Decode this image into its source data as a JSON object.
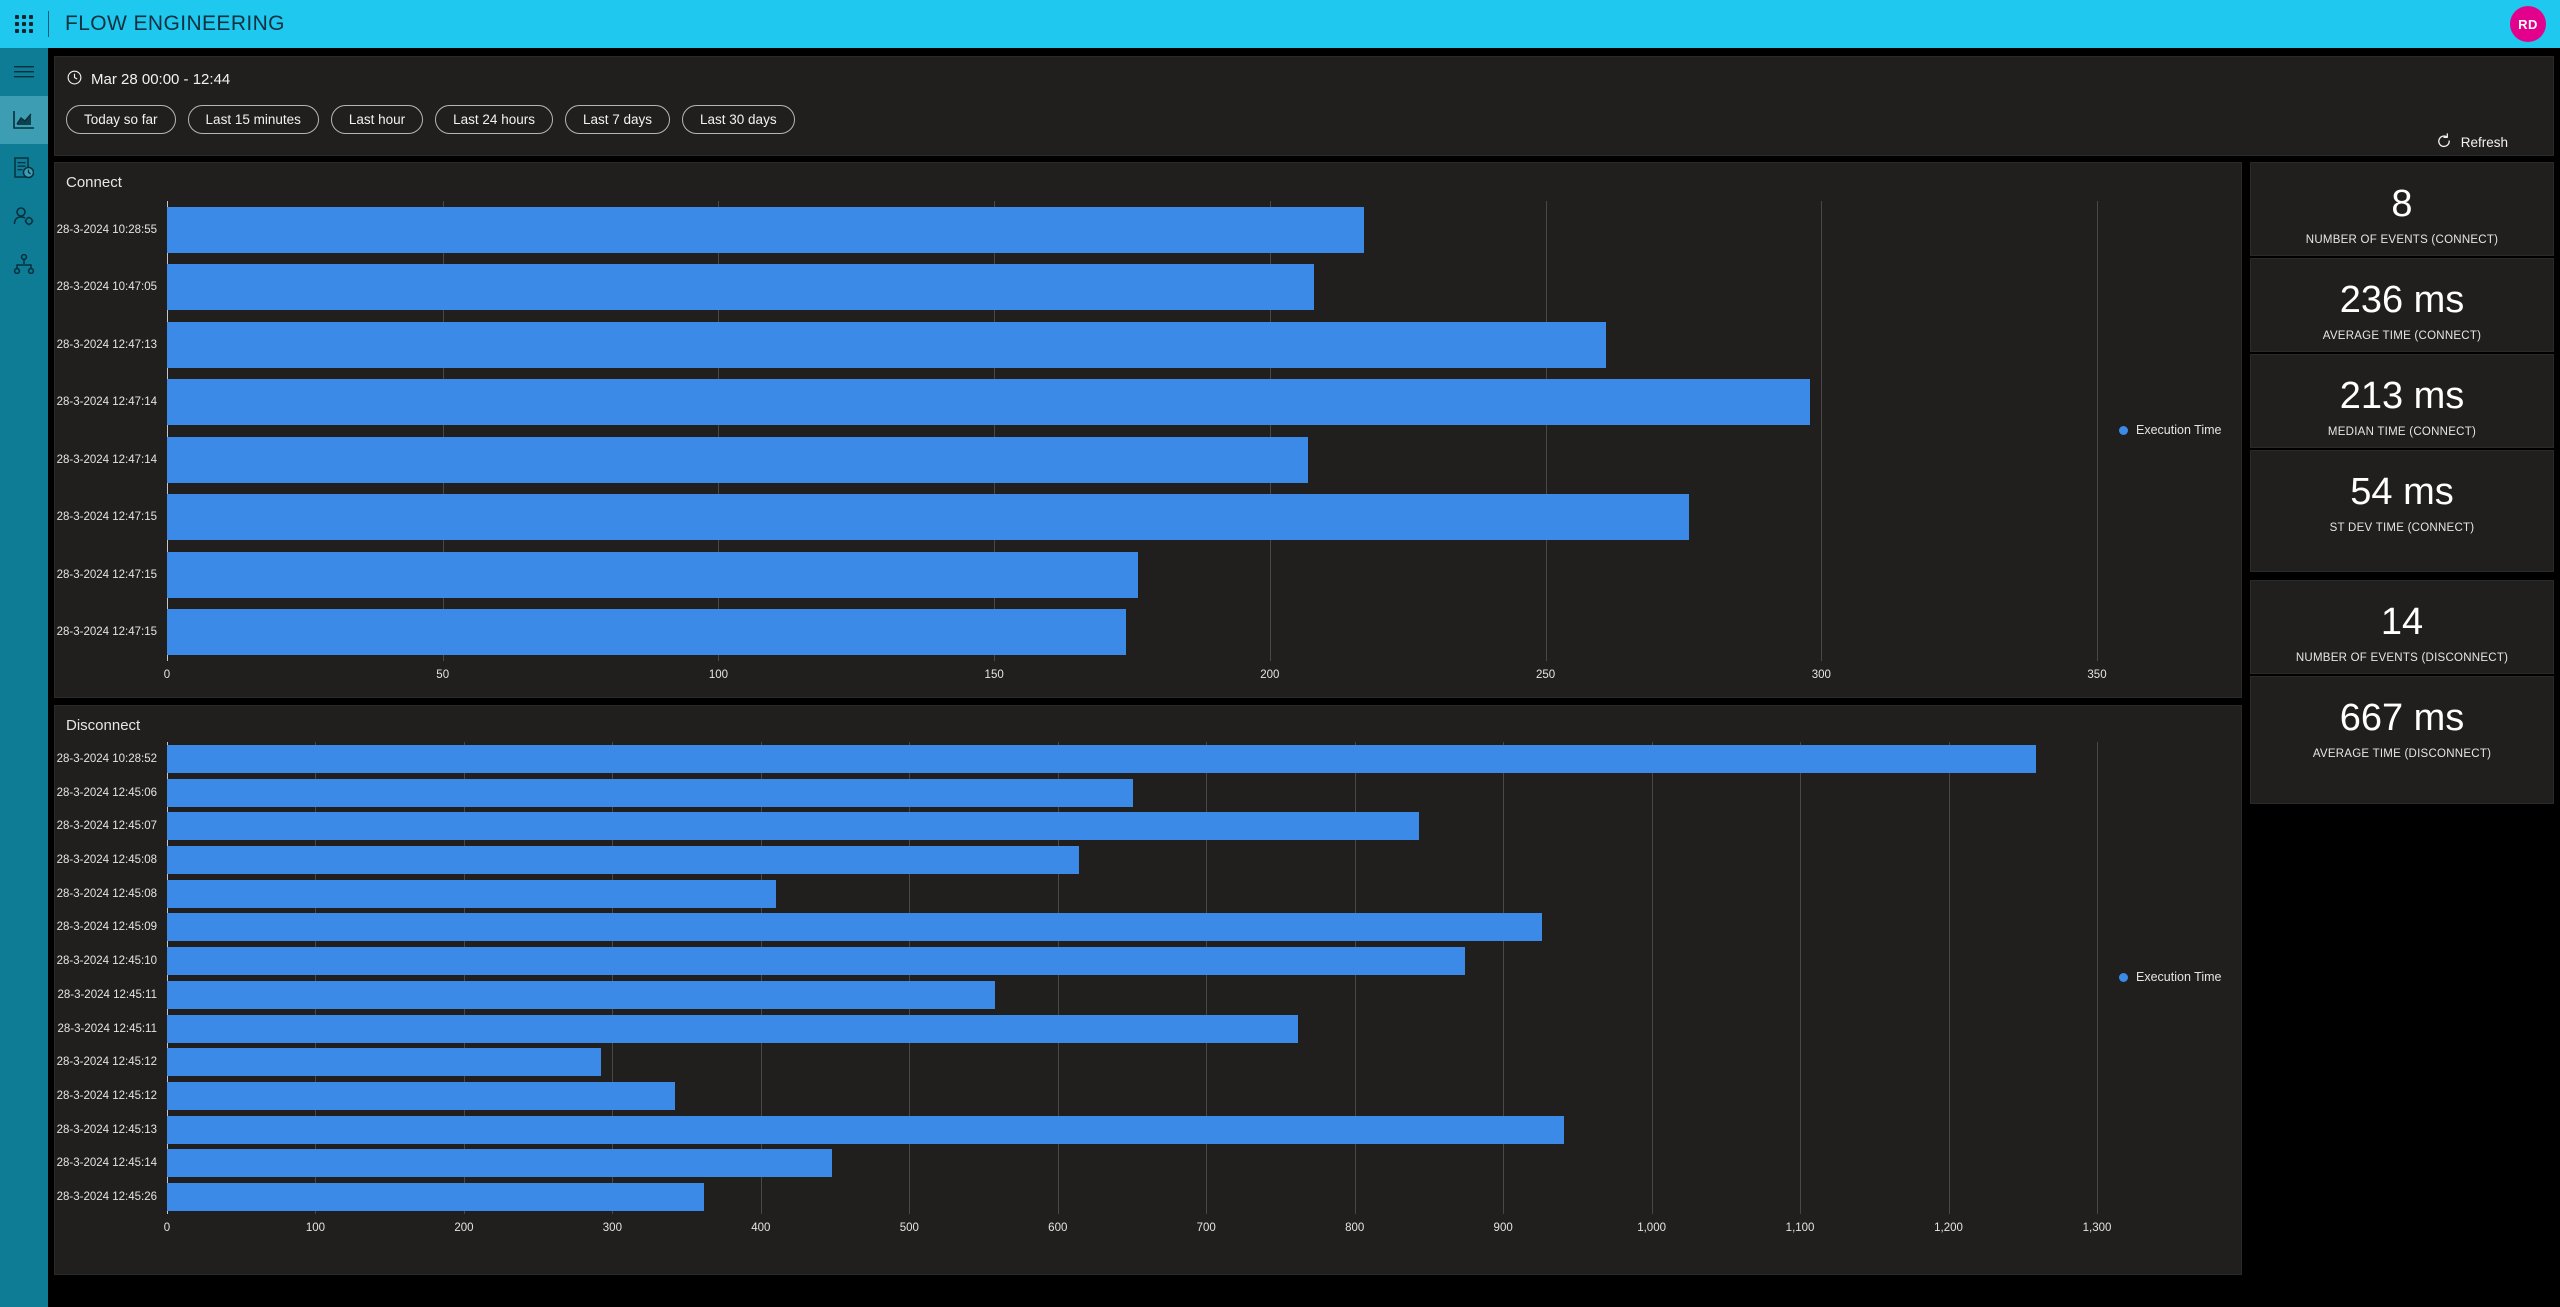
{
  "topbar": {
    "waffle_icon": "app-launcher-icon",
    "app_title": "FLOW ENGINEERING",
    "avatar_initials": "RD",
    "avatar_color": "#e3008c",
    "background_color": "#1ec8ee"
  },
  "rail": {
    "items": [
      {
        "icon": "hamburger-menu-icon",
        "name": "menu",
        "active": false
      },
      {
        "icon": "chart-report-icon",
        "name": "reports",
        "active": true
      },
      {
        "icon": "document-clock-icon",
        "name": "scheduled-documents",
        "active": false
      },
      {
        "icon": "user-settings-icon",
        "name": "user-settings",
        "active": false
      },
      {
        "icon": "workflow-branch-icon",
        "name": "workflows",
        "active": false
      }
    ]
  },
  "timepanel": {
    "clock_icon": "clock-icon",
    "range_label": "Mar 28 00:00 - 12:44",
    "pills": [
      "Today so far",
      "Last 15 minutes",
      "Last hour",
      "Last 24 hours",
      "Last 7 days",
      "Last 30 days"
    ]
  },
  "legend_label": "Execution Time",
  "accent_color": "#3b8ae8",
  "kpis": [
    {
      "value": "8",
      "label": "NUMBER OF EVENTS (CONNECT)",
      "size": 38
    },
    {
      "value": "236 ms",
      "label": "AVERAGE TIME (CONNECT)",
      "size": 38
    },
    {
      "value": "213 ms",
      "label": "MEDIAN TIME (CONNECT)",
      "size": 38
    },
    {
      "value": "54 ms",
      "label": "ST DEV TIME (CONNECT)",
      "size": 38
    },
    {
      "value": "14",
      "label": "NUMBER OF EVENTS (DISCONNECT)",
      "size": 38
    },
    {
      "value": "667 ms",
      "label": "AVERAGE TIME (DISCONNECT)",
      "size": 38
    }
  ],
  "refresh": {
    "icon": "refresh-icon",
    "label": "Refresh"
  },
  "chart_data": [
    {
      "type": "bar",
      "orientation": "horizontal",
      "title": "Connect",
      "xlabel": "",
      "ylabel": "",
      "xlim": [
        0,
        350
      ],
      "xticks": [
        0,
        50,
        100,
        150,
        200,
        250,
        300,
        350
      ],
      "grid": true,
      "legend": [
        "Execution Time"
      ],
      "legend_position": "right",
      "categories": [
        "28-3-2024 10:28:55",
        "28-3-2024 10:47:05",
        "28-3-2024 12:47:13",
        "28-3-2024 12:47:14",
        "28-3-2024 12:47:14",
        "28-3-2024 12:47:15",
        "28-3-2024 12:47:15",
        "28-3-2024 12:47:15"
      ],
      "values": [
        217,
        208,
        261,
        298,
        207,
        276,
        176,
        174
      ]
    },
    {
      "type": "bar",
      "orientation": "horizontal",
      "title": "Disconnect",
      "xlabel": "",
      "ylabel": "",
      "xlim": [
        0,
        1300
      ],
      "xticks": [
        0,
        100,
        200,
        300,
        400,
        500,
        600,
        700,
        800,
        900,
        1000,
        1100,
        1200,
        1300
      ],
      "xtick_labels": [
        "0",
        "100",
        "200",
        "300",
        "400",
        "500",
        "600",
        "700",
        "800",
        "900",
        "1,000",
        "1,100",
        "1,200",
        "1,300"
      ],
      "grid": true,
      "legend": [
        "Execution Time"
      ],
      "legend_position": "right",
      "categories": [
        "28-3-2024 10:28:52",
        "28-3-2024 12:45:06",
        "28-3-2024 12:45:07",
        "28-3-2024 12:45:08",
        "28-3-2024 12:45:08",
        "28-3-2024 12:45:09",
        "28-3-2024 12:45:10",
        "28-3-2024 12:45:11",
        "28-3-2024 12:45:11",
        "28-3-2024 12:45:12",
        "28-3-2024 12:45:12",
        "28-3-2024 12:45:13",
        "28-3-2024 12:45:14",
        "28-3-2024 12:45:26"
      ],
      "values": [
        1259,
        651,
        843,
        614,
        410,
        926,
        874,
        558,
        762,
        292,
        342,
        941,
        448,
        362
      ]
    }
  ]
}
